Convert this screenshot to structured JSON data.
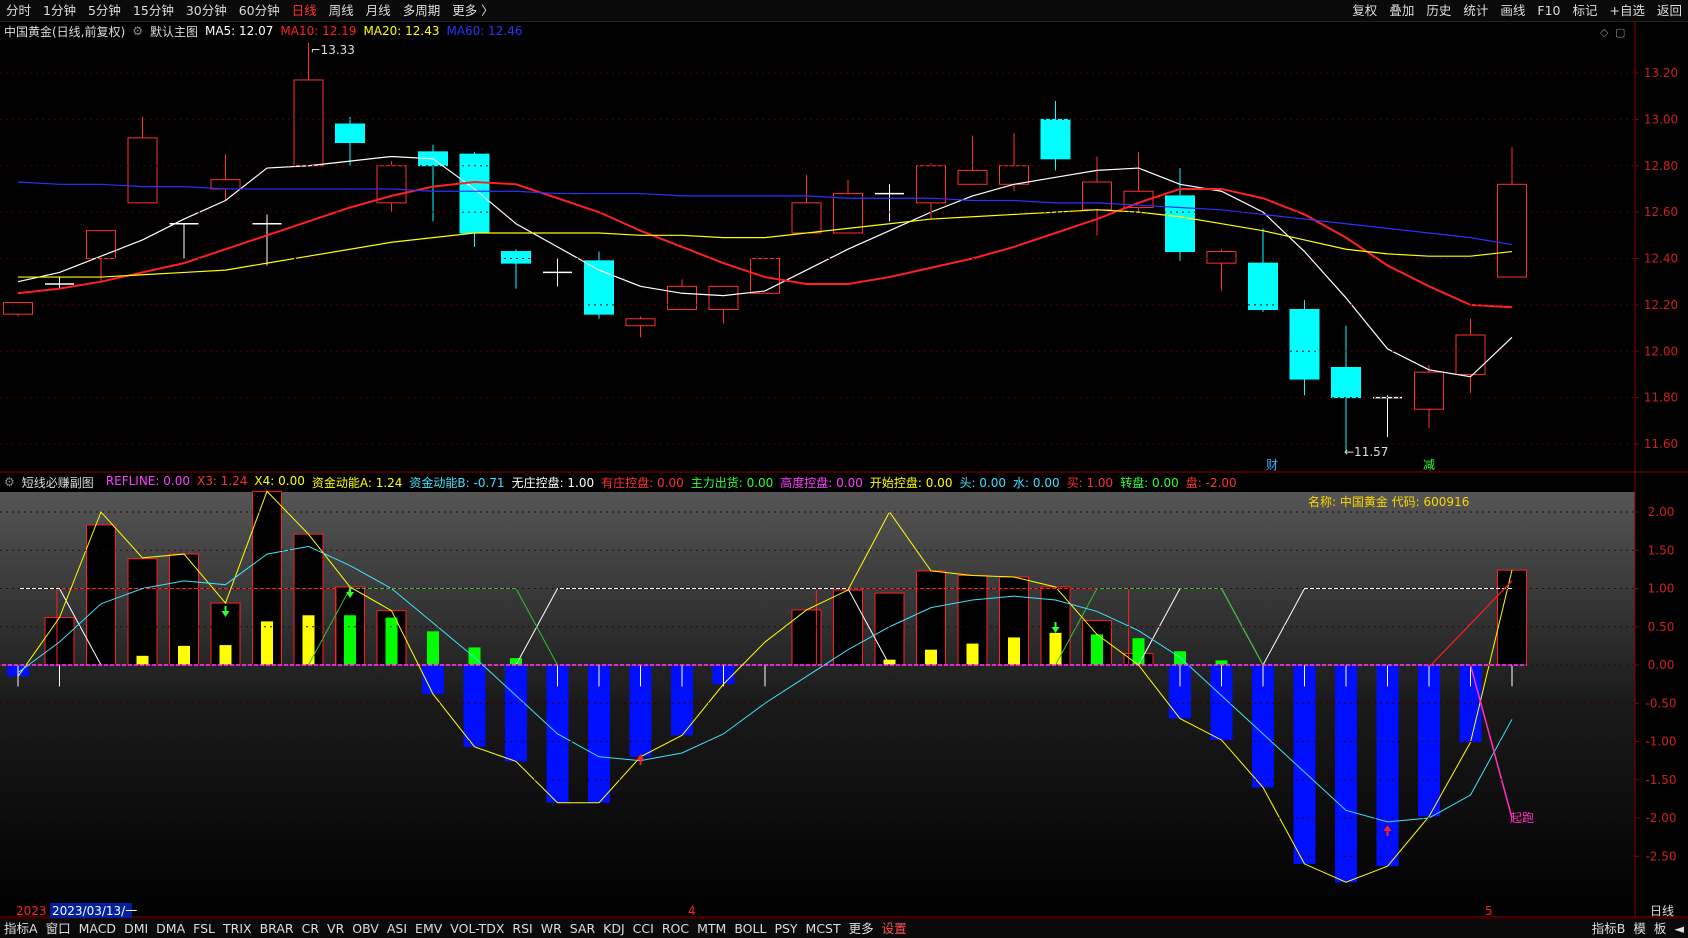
{
  "toolbar": {
    "periods": [
      "分时",
      "1分钟",
      "5分钟",
      "15分钟",
      "30分钟",
      "60分钟",
      "日线",
      "周线",
      "月线",
      "多周期",
      "更多 〉"
    ],
    "active_index": 6,
    "right_buttons": [
      "复权",
      "叠加",
      "历史",
      "统计",
      "画线",
      "F10",
      "标记",
      "+自选",
      "返回"
    ]
  },
  "main_legend": {
    "title": "中国黄金(日线,前复权)",
    "indicator_name": "默认主图",
    "ma5": "MA5: 12.07",
    "ma10": "MA10: 12.19",
    "ma20": "MA20: 12.43",
    "ma60": "MA60: 12.46",
    "colors": {
      "ma5": "#ffffff",
      "ma10": "#ff2020",
      "ma20": "#ffff00",
      "ma60": "#3030ff"
    }
  },
  "sub_legend": {
    "name": "短线必赚副图",
    "items": [
      {
        "text": "REFLINE: 0.00",
        "color": "#ff40ff"
      },
      {
        "text": "X3: 1.24",
        "color": "#ff3030"
      },
      {
        "text": "X4: 0.00",
        "color": "#ffff00"
      },
      {
        "text": "资金动能A: 1.24",
        "color": "#ffff00"
      },
      {
        "text": "资金动能B: -0.71",
        "color": "#40e0ff"
      },
      {
        "text": "无庄控盘: 1.00",
        "color": "#ffffff"
      },
      {
        "text": "有庄控盘: 0.00",
        "color": "#ff3030"
      },
      {
        "text": "主力出货: 0.00",
        "color": "#30ff30"
      },
      {
        "text": "高度控盘: 0.00",
        "color": "#ff40ff"
      },
      {
        "text": "开始控盘: 0.00",
        "color": "#ffff00"
      },
      {
        "text": "头: 0.00",
        "color": "#40e0ff"
      },
      {
        "text": "水: 0.00",
        "color": "#40e0ff"
      },
      {
        "text": "买: 1.00",
        "color": "#ff3030"
      },
      {
        "text": "转盘: 0.00",
        "color": "#30ff30"
      },
      {
        "text": "盘: -2.00",
        "color": "#ff3030"
      }
    ],
    "stock_info": "名称: 中国黄金 代码: 600916"
  },
  "main_axis": {
    "ticks": [
      "13.20",
      "13.00",
      "12.80",
      "12.60",
      "12.40",
      "12.20",
      "12.00",
      "11.80",
      "11.60"
    ]
  },
  "sub_axis": {
    "ticks": [
      "2.00",
      "1.50",
      "1.00",
      "0.50",
      "0.00",
      "-0.50",
      "-1.00",
      "-1.50",
      "-2.00",
      "-2.50"
    ]
  },
  "annotations": {
    "high": "13.33",
    "low": "←11.57",
    "mark_cai": "财",
    "mark_jian": "减",
    "qipao": "起跑"
  },
  "date_axis": {
    "year_label": "2023",
    "cursor_date": "2023/03/13/一",
    "month_a": "4",
    "month_b": "5",
    "period": "日线"
  },
  "bottom_tabs": [
    "指标A",
    "窗口",
    "MACD",
    "DMI",
    "DMA",
    "FSL",
    "TRIX",
    "BRAR",
    "CR",
    "VR",
    "OBV",
    "ASI",
    "EMV",
    "VOL-TDX",
    "RSI",
    "WR",
    "SAR",
    "KDJ",
    "CCI",
    "ROC",
    "MTM",
    "BOLL",
    "PSY",
    "MCST",
    "更多",
    "设置"
  ],
  "bottom_right": [
    "指标B",
    "模",
    "板",
    "◄"
  ],
  "chart_data": [
    {
      "type": "candlestick",
      "title": "中国黄金(日线,前复权)",
      "ylim": [
        11.55,
        13.38
      ],
      "candles": [
        {
          "o": 12.16,
          "h": 12.21,
          "l": 12.15,
          "c": 12.21
        },
        {
          "o": 12.29,
          "h": 12.32,
          "l": 12.27,
          "c": 12.29
        },
        {
          "o": 12.4,
          "h": 12.52,
          "l": 12.3,
          "c": 12.52
        },
        {
          "o": 12.64,
          "h": 13.01,
          "l": 12.64,
          "c": 12.92
        },
        {
          "o": 12.55,
          "h": 12.55,
          "l": 12.4,
          "c": 12.55
        },
        {
          "o": 12.7,
          "h": 12.85,
          "l": 12.65,
          "c": 12.74
        },
        {
          "o": 12.55,
          "h": 12.59,
          "l": 12.37,
          "c": 12.55
        },
        {
          "o": 12.8,
          "h": 13.33,
          "l": 12.8,
          "c": 13.17
        },
        {
          "o": 12.98,
          "h": 13.01,
          "l": 12.8,
          "c": 12.9
        },
        {
          "o": 12.64,
          "h": 12.82,
          "l": 12.6,
          "c": 12.8
        },
        {
          "o": 12.86,
          "h": 12.89,
          "l": 12.56,
          "c": 12.8
        },
        {
          "o": 12.85,
          "h": 12.86,
          "l": 12.45,
          "c": 12.51
        },
        {
          "o": 12.43,
          "h": 12.44,
          "l": 12.27,
          "c": 12.38
        },
        {
          "o": 12.34,
          "h": 12.4,
          "l": 12.28,
          "c": 12.34
        },
        {
          "o": 12.39,
          "h": 12.43,
          "l": 12.14,
          "c": 12.16
        },
        {
          "o": 12.11,
          "h": 12.15,
          "l": 12.06,
          "c": 12.14
        },
        {
          "o": 12.18,
          "h": 12.31,
          "l": 12.18,
          "c": 12.28
        },
        {
          "o": 12.18,
          "h": 12.27,
          "l": 12.12,
          "c": 12.28
        },
        {
          "o": 12.25,
          "h": 12.4,
          "l": 12.25,
          "c": 12.4
        },
        {
          "o": 12.51,
          "h": 12.76,
          "l": 12.51,
          "c": 12.64
        },
        {
          "o": 12.51,
          "h": 12.74,
          "l": 12.51,
          "c": 12.68
        },
        {
          "o": 12.68,
          "h": 12.72,
          "l": 12.56,
          "c": 12.68
        },
        {
          "o": 12.64,
          "h": 12.81,
          "l": 12.57,
          "c": 12.8
        },
        {
          "o": 12.72,
          "h": 12.93,
          "l": 12.72,
          "c": 12.78
        },
        {
          "o": 12.72,
          "h": 12.94,
          "l": 12.69,
          "c": 12.8
        },
        {
          "o": 13.0,
          "h": 13.08,
          "l": 12.78,
          "c": 12.83
        },
        {
          "o": 12.61,
          "h": 12.84,
          "l": 12.5,
          "c": 12.73
        },
        {
          "o": 12.62,
          "h": 12.86,
          "l": 12.6,
          "c": 12.69
        },
        {
          "o": 12.67,
          "h": 12.79,
          "l": 12.39,
          "c": 12.43
        },
        {
          "o": 12.38,
          "h": 12.44,
          "l": 12.26,
          "c": 12.43
        },
        {
          "o": 12.38,
          "h": 12.53,
          "l": 12.17,
          "c": 12.18
        },
        {
          "o": 12.18,
          "h": 12.22,
          "l": 11.81,
          "c": 11.88
        },
        {
          "o": 11.93,
          "h": 12.11,
          "l": 11.57,
          "c": 11.8
        },
        {
          "o": 11.8,
          "h": 11.81,
          "l": 11.63,
          "c": 11.8
        },
        {
          "o": 11.75,
          "h": 11.94,
          "l": 11.67,
          "c": 11.91
        },
        {
          "o": 11.9,
          "h": 12.14,
          "l": 11.82,
          "c": 12.07
        },
        {
          "o": 12.32,
          "h": 12.88,
          "l": 12.32,
          "c": 12.72
        }
      ],
      "series": [
        {
          "name": "MA5",
          "color": "#ffffff",
          "values": [
            12.3,
            12.34,
            12.41,
            12.48,
            12.57,
            12.65,
            12.79,
            12.8,
            12.82,
            12.84,
            12.83,
            12.7,
            12.55,
            12.45,
            12.35,
            12.28,
            12.25,
            12.24,
            12.26,
            12.35,
            12.44,
            12.52,
            12.6,
            12.67,
            12.72,
            12.75,
            12.78,
            12.79,
            12.72,
            12.69,
            12.6,
            12.43,
            12.23,
            12.01,
            11.92,
            11.89,
            12.06
          ]
        },
        {
          "name": "MA10",
          "color": "#ff2020",
          "values": [
            12.25,
            12.27,
            12.3,
            12.34,
            12.38,
            12.44,
            12.5,
            12.56,
            12.62,
            12.67,
            12.71,
            12.73,
            12.72,
            12.66,
            12.6,
            12.52,
            12.45,
            12.38,
            12.32,
            12.29,
            12.29,
            12.32,
            12.36,
            12.4,
            12.45,
            12.51,
            12.57,
            12.64,
            12.7,
            12.7,
            12.66,
            12.59,
            12.49,
            12.37,
            12.28,
            12.2,
            12.19
          ]
        },
        {
          "name": "MA20",
          "color": "#ffff00",
          "values": [
            12.32,
            12.32,
            12.32,
            12.33,
            12.34,
            12.35,
            12.38,
            12.41,
            12.44,
            12.47,
            12.49,
            12.51,
            12.51,
            12.51,
            12.51,
            12.5,
            12.5,
            12.49,
            12.49,
            12.51,
            12.53,
            12.55,
            12.57,
            12.58,
            12.59,
            12.6,
            12.61,
            12.6,
            12.58,
            12.55,
            12.52,
            12.48,
            12.44,
            12.42,
            12.41,
            12.41,
            12.43
          ]
        },
        {
          "name": "MA60",
          "color": "#3030ff",
          "values": [
            12.73,
            12.72,
            12.72,
            12.71,
            12.71,
            12.7,
            12.7,
            12.7,
            12.7,
            12.7,
            12.69,
            12.69,
            12.69,
            12.68,
            12.68,
            12.68,
            12.67,
            12.67,
            12.67,
            12.67,
            12.66,
            12.66,
            12.66,
            12.65,
            12.65,
            12.64,
            12.64,
            12.63,
            12.62,
            12.61,
            12.59,
            12.57,
            12.55,
            12.53,
            12.51,
            12.49,
            12.46
          ]
        }
      ]
    },
    {
      "type": "bar",
      "title": "短线必赚副图",
      "ylim": [
        -2.9,
        2.25
      ],
      "outlined_bars": [
        0,
        0.62,
        1.83,
        1.39,
        1.45,
        0.81,
        2.27,
        1.71,
        1.02,
        0.71,
        0,
        0,
        0,
        0,
        0,
        0,
        0,
        0,
        0,
        0.72,
        0.98,
        0.94,
        1.23,
        1.17,
        1.15,
        1.02,
        0.58,
        0.15,
        0,
        0,
        0,
        0,
        0,
        0,
        0,
        0,
        1.24
      ],
      "yellow_bars": [
        0,
        0,
        0,
        0.12,
        0.25,
        0.26,
        0.57,
        0.65,
        0,
        0,
        0,
        0,
        0,
        0,
        0,
        0,
        0,
        0,
        0,
        0,
        0,
        0.07,
        0.2,
        0.28,
        0.36,
        0.42,
        0,
        0,
        0,
        0,
        0,
        0,
        0,
        0,
        0,
        0,
        0
      ],
      "green_bars": [
        0,
        0,
        0,
        0,
        0,
        0,
        0,
        0,
        0.65,
        0.62,
        0.44,
        0.23,
        0.09,
        0,
        0,
        0,
        0,
        0,
        0,
        0,
        0,
        0,
        0,
        0,
        0,
        0,
        0.4,
        0.35,
        0.18,
        0.06,
        0,
        0,
        0,
        0,
        0,
        0,
        0
      ],
      "blue_bars": [
        -0.15,
        0,
        0,
        0,
        0,
        0,
        0,
        0,
        0,
        0,
        -0.38,
        -1.07,
        -1.26,
        -1.8,
        -1.8,
        -1.2,
        -0.92,
        -0.25,
        0,
        0,
        0,
        0,
        0,
        0,
        0,
        0,
        0,
        0,
        -0.7,
        -0.98,
        -1.6,
        -2.6,
        -2.84,
        -2.63,
        -1.98,
        -1.01,
        0
      ],
      "series": [
        {
          "name": "资金动能A",
          "color": "#ffff00",
          "values": [
            -0.15,
            0.62,
            2.0,
            1.4,
            1.45,
            0.81,
            2.27,
            1.71,
            1.02,
            0.71,
            -0.38,
            -1.07,
            -1.26,
            -1.8,
            -1.8,
            -1.2,
            -0.92,
            -0.25,
            0.3,
            0.72,
            0.98,
            2.0,
            1.23,
            1.17,
            1.15,
            1.02,
            0.4,
            0.0,
            -0.7,
            -0.98,
            -1.6,
            -2.6,
            -2.84,
            -2.63,
            -1.98,
            -1.01,
            1.24
          ]
        },
        {
          "name": "资金动能B",
          "color": "#40e0ff",
          "values": [
            -0.1,
            0.3,
            0.8,
            1.0,
            1.1,
            1.05,
            1.45,
            1.55,
            1.3,
            1.0,
            0.55,
            0.1,
            -0.4,
            -0.9,
            -1.2,
            -1.25,
            -1.15,
            -0.9,
            -0.5,
            -0.15,
            0.2,
            0.5,
            0.75,
            0.85,
            0.9,
            0.85,
            0.7,
            0.45,
            0.1,
            -0.4,
            -0.9,
            -1.4,
            -1.9,
            -2.05,
            -2.0,
            -1.7,
            -0.71
          ]
        },
        {
          "name": "无庄控盘",
          "color": "#ffffff",
          "values": [
            1,
            1,
            0,
            0,
            0,
            0,
            0,
            0,
            0,
            0,
            0,
            0,
            0,
            1,
            1,
            1,
            1,
            1,
            1,
            1,
            1,
            0,
            0,
            0,
            0,
            0,
            0,
            0,
            1,
            1,
            0,
            1,
            1,
            1,
            1,
            1,
            1
          ]
        },
        {
          "name": "主力出货",
          "color": "#30ff30",
          "values": [
            0,
            0,
            0,
            0,
            0,
            0,
            0,
            0,
            1,
            1,
            1,
            1,
            1,
            0,
            0,
            0,
            0,
            0,
            0,
            0,
            0,
            0,
            0,
            0,
            0,
            0,
            1,
            1,
            1,
            1,
            0,
            0,
            0,
            0,
            0,
            0,
            0
          ]
        }
      ]
    }
  ]
}
